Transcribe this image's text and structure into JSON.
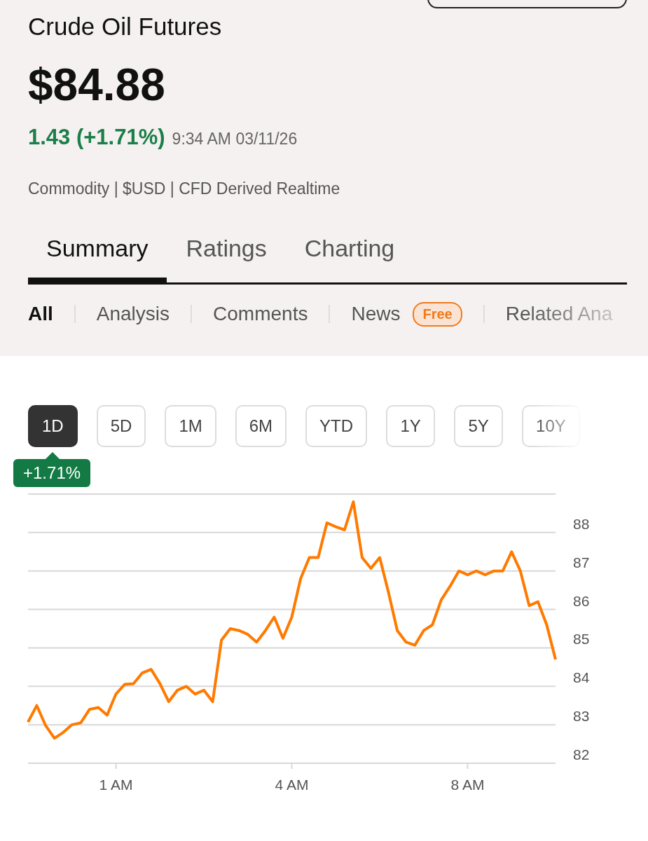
{
  "title": "Crude Oil Futures",
  "price": "$84.88",
  "change": "1.43 (+1.71%)",
  "timestamp": "9:34 AM 03/11/26",
  "meta": "Commodity | $USD | CFD Derived Realtime",
  "tabs": [
    {
      "label": "Summary",
      "selected": true
    },
    {
      "label": "Ratings",
      "selected": false
    },
    {
      "label": "Charting",
      "selected": false
    }
  ],
  "subtabs": [
    {
      "label": "All",
      "selected": true
    },
    {
      "label": "Analysis",
      "selected": false
    },
    {
      "label": "Comments",
      "selected": false
    },
    {
      "label": "News",
      "selected": false,
      "badge": "Free"
    },
    {
      "label": "Related Ana",
      "selected": false
    }
  ],
  "ranges": [
    {
      "label": "1D",
      "selected": true
    },
    {
      "label": "5D",
      "selected": false
    },
    {
      "label": "1M",
      "selected": false
    },
    {
      "label": "6M",
      "selected": false
    },
    {
      "label": "YTD",
      "selected": false
    },
    {
      "label": "1Y",
      "selected": false
    },
    {
      "label": "5Y",
      "selected": false
    },
    {
      "label": "10Y",
      "selected": false
    }
  ],
  "range_change": "+1.71%",
  "chart_data": {
    "type": "line",
    "categories": [
      null,
      null,
      null,
      null,
      null,
      null,
      null,
      null,
      null,
      null,
      "1 AM",
      null,
      null,
      null,
      null,
      null,
      null,
      null,
      null,
      null,
      null,
      null,
      null,
      null,
      null,
      null,
      null,
      null,
      null,
      null,
      "4 AM",
      null,
      null,
      null,
      null,
      null,
      null,
      null,
      null,
      null,
      null,
      null,
      null,
      null,
      null,
      null,
      null,
      null,
      null,
      null,
      "8 AM",
      null,
      null,
      null,
      null,
      null,
      null,
      null,
      null,
      null,
      null
    ],
    "series": [
      {
        "color": "#ff7a00",
        "values": [
          83.07,
          83.5,
          82.98,
          82.65,
          82.8,
          83.0,
          83.05,
          83.4,
          83.45,
          83.25,
          83.8,
          84.05,
          84.07,
          84.35,
          84.44,
          84.07,
          83.6,
          83.9,
          84.0,
          83.8,
          83.9,
          83.6,
          85.2,
          85.5,
          85.45,
          85.35,
          85.15,
          85.45,
          85.8,
          85.25,
          85.8,
          86.8,
          87.35,
          87.35,
          88.25,
          88.15,
          88.07,
          88.8,
          87.35,
          87.07,
          87.35,
          86.45,
          85.45,
          85.15,
          85.07,
          85.45,
          85.6,
          86.25,
          86.6,
          87.0,
          86.9,
          87.0,
          86.9,
          87.0,
          87.0,
          87.5,
          87.0,
          86.1,
          86.2,
          85.6,
          84.7
        ]
      }
    ],
    "ylim": [
      82,
      89
    ],
    "grid": true,
    "yticks": [
      82,
      83,
      84,
      85,
      86,
      87,
      88
    ]
  }
}
